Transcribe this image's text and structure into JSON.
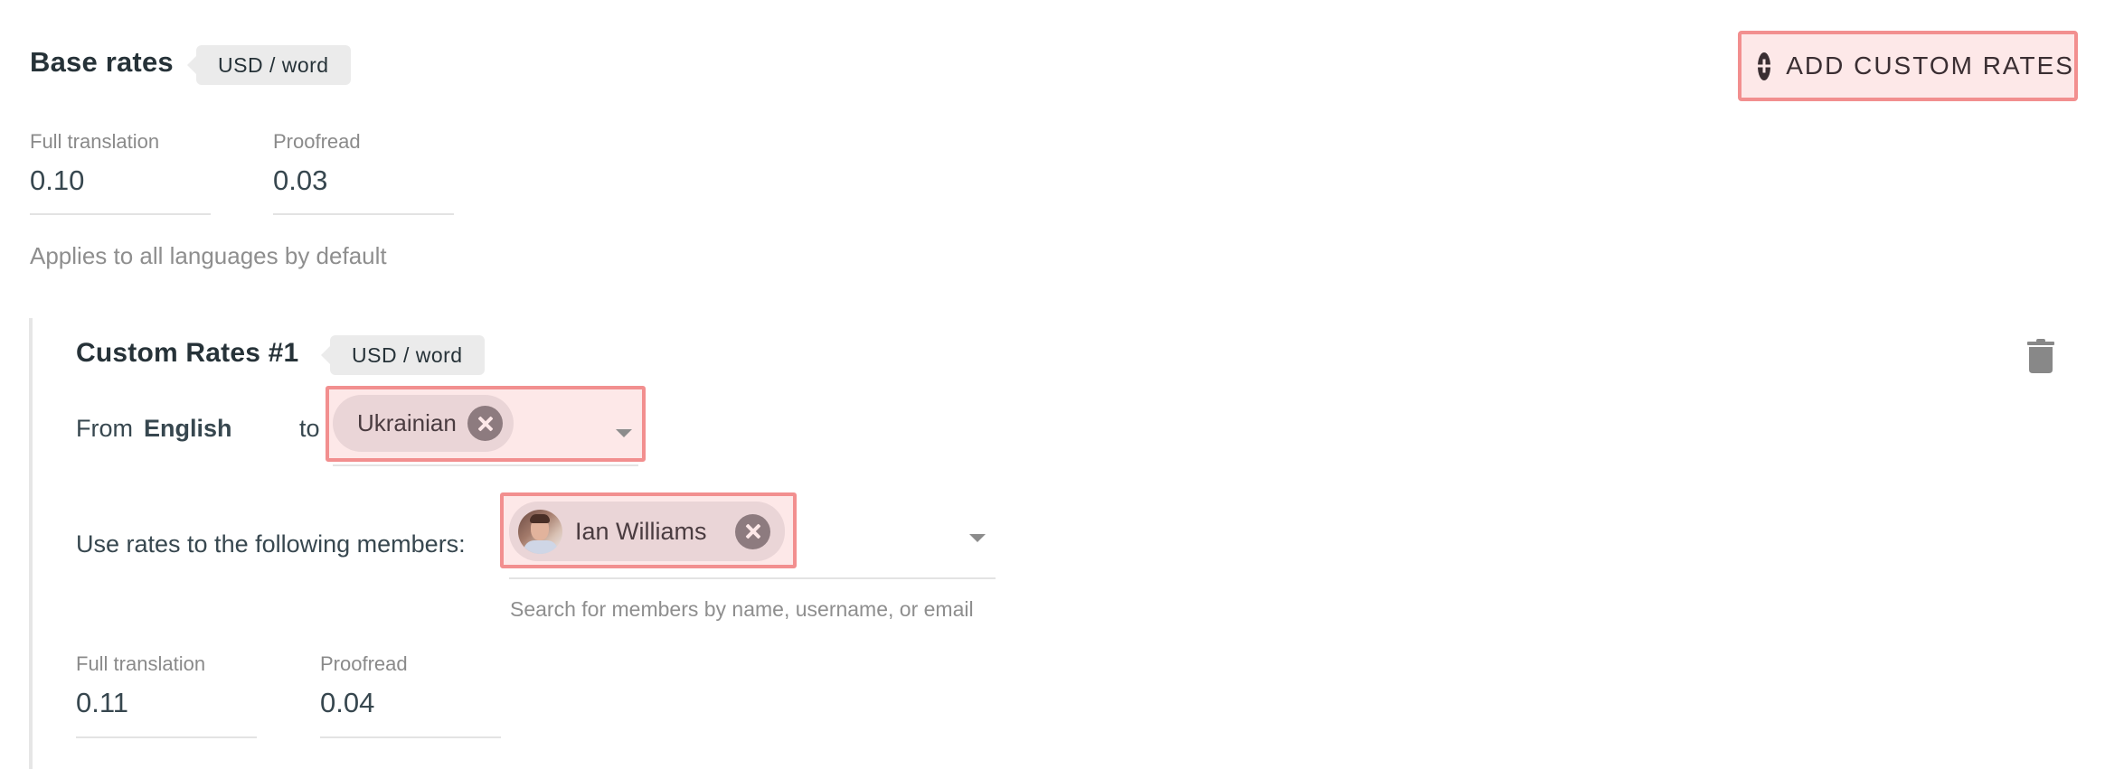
{
  "base_rates": {
    "title": "Base rates",
    "unit_badge": "USD / word",
    "fields": [
      {
        "label": "Full translation",
        "value": "0.10"
      },
      {
        "label": "Proofread",
        "value": "0.03"
      }
    ],
    "hint": "Applies to all languages by default"
  },
  "toolbar": {
    "add_custom_rates_label": "ADD CUSTOM RATES",
    "add_icon": "plus-circle-icon"
  },
  "custom_rates": [
    {
      "title": "Custom Rates #1",
      "unit_badge": "USD / word",
      "delete_icon": "trash-icon",
      "from_label": "From",
      "source_language": "English",
      "to_label": "to",
      "target_languages": [
        "Ukrainian"
      ],
      "members_label": "Use rates to the following members:",
      "members": [
        {
          "name": "Ian Williams",
          "avatar_icon": "user-avatar"
        }
      ],
      "members_helper": "Search for members by name, username, or email",
      "fields": [
        {
          "label": "Full translation",
          "value": "0.11"
        },
        {
          "label": "Proofread",
          "value": "0.04"
        }
      ]
    }
  ],
  "colors": {
    "highlight_border": "#f28f8f",
    "highlight_fill": "#fde8e8",
    "chip_fill": "#ead5d7",
    "chip_close": "#8d7b7f",
    "text_primary": "#263238",
    "text_muted": "#8a8a8a"
  }
}
